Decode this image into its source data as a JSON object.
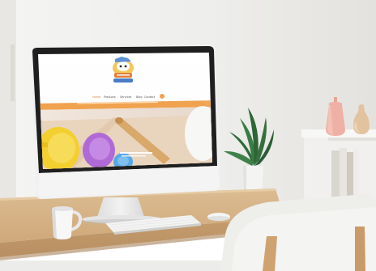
{
  "scene": {
    "subject": "photograph-of-desk-with-monitor-showing-website"
  },
  "website": {
    "nav": [
      "Home",
      "Products",
      "Services",
      "Blog",
      "Contact"
    ],
    "nav_active_index": 0
  },
  "colors": {
    "wall": "#ecebe8",
    "desk_top": "#d7b488",
    "desk_front": "#c9a478",
    "monitor_bezel": "#1f1f1f",
    "monitor_stand": "#e9e9e9",
    "site_accent": "#f0a24f",
    "cup_yellow": "#f3cf2f",
    "cup_purple": "#b06ad6",
    "cup_blue": "#58a7e6",
    "vase_pink": "#efb1a6",
    "vase_beige": "#e2c3a0",
    "plant": "#2f6b3a",
    "chair": "#f2f2f0"
  }
}
